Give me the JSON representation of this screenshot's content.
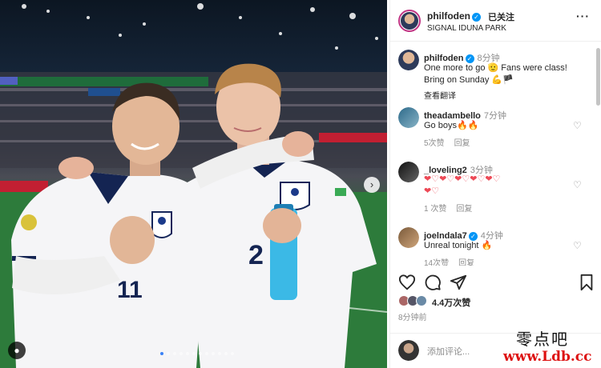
{
  "post": {
    "username": "philfoden",
    "follow_label": "已关注",
    "location": "SIGNAL IDUNA PARK",
    "more_icon": "more-dots-icon",
    "caption": {
      "username": "philfoden",
      "time": "8分钟",
      "text_line1": "One more to go 🫡 Fans were class!",
      "text_line2": "Bring on Sunday 💪🏴",
      "translate": "查看翻译"
    }
  },
  "comments": [
    {
      "username": "theadambello",
      "time": "7分钟",
      "text": "Go boys🔥🔥",
      "likes": "5次赞",
      "reply": "回复"
    },
    {
      "username": "_loveling2",
      "time": "3分钟",
      "text_line1": "❤♡❤♡❤♡❤♡❤♡",
      "text_line2": "❤♡",
      "likes": "1 次赞",
      "reply": "回复"
    },
    {
      "username": "joelndala7",
      "time": "4分钟",
      "text": "Unreal tonight 🔥",
      "likes": "14次赞",
      "reply": "回复"
    }
  ],
  "footer": {
    "likes_count": "4.4万次赞",
    "posted_ago": "8分钟前",
    "comment_placeholder": "添加评论..."
  },
  "photo": {
    "jersey_numbers": [
      "11",
      "2"
    ],
    "bottle_label": "",
    "carousel_total": 12,
    "carousel_active": 0
  },
  "watermark": {
    "line1": "零点吧",
    "line2": "www.Ldb.cc"
  },
  "colors": {
    "link_blue": "#0095f6",
    "heart_red": "#ed4956",
    "pitch_green": "#2c7a3a"
  }
}
